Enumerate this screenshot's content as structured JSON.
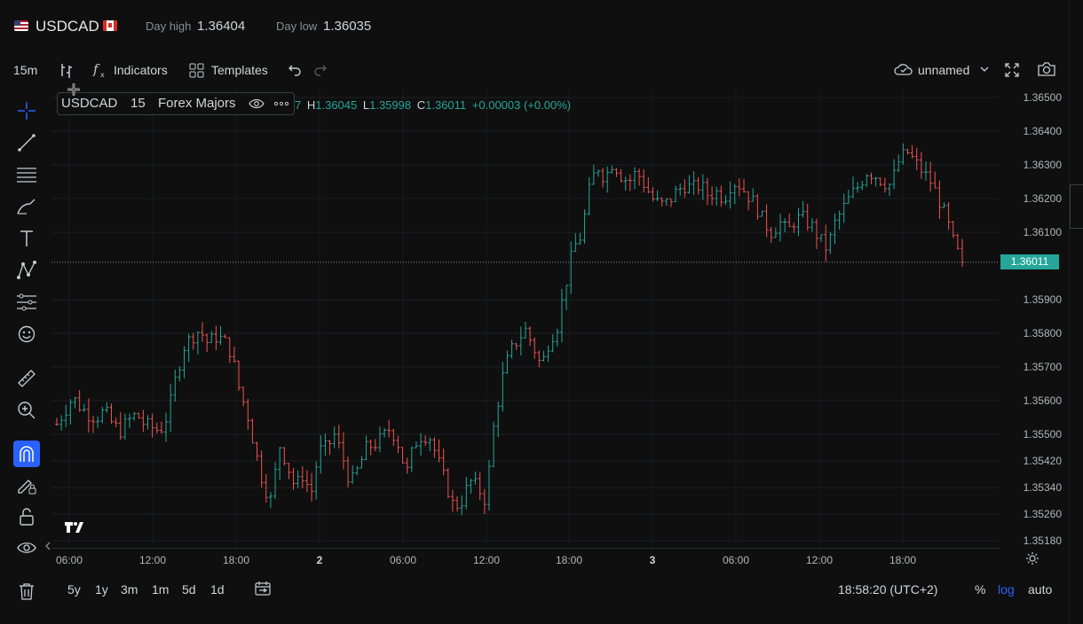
{
  "header": {
    "symbol": "USDCAD",
    "day_high_label": "Day high",
    "day_high_value": "1.36404",
    "day_low_label": "Day low",
    "day_low_value": "1.36035"
  },
  "toolbar": {
    "interval": "15m",
    "indicators_label": "Indicators",
    "templates_label": "Templates",
    "layout_name": "unnamed"
  },
  "legend": {
    "symbol": "USDCAD",
    "interval": "15",
    "exchange": "Forex Majors",
    "open_partial": "7",
    "h_label": "H",
    "h_value": "1.36045",
    "l_label": "L",
    "l_value": "1.35998",
    "c_label": "C",
    "c_value": "1.36011",
    "change": "+0.00003 (+0.00%)"
  },
  "price_axis": {
    "ticks": [
      "1.36500",
      "1.36400",
      "1.36300",
      "1.36200",
      "1.36100",
      "1.35900",
      "1.35800",
      "1.35700",
      "1.35600",
      "1.35500",
      "1.35420",
      "1.35340",
      "1.35260",
      "1.35180"
    ],
    "last_price": "1.36011",
    "last_price_color": "#26a69a"
  },
  "time_axis": {
    "ticks": [
      "06:00",
      "12:00",
      "18:00",
      "2",
      "06:00",
      "12:00",
      "18:00",
      "3",
      "06:00",
      "12:00",
      "18:00"
    ]
  },
  "bottom_bar": {
    "ranges": [
      "5y",
      "1y",
      "3m",
      "1m",
      "5d",
      "1d"
    ],
    "clock": "18:58:20 (UTC+2)",
    "percent": "%",
    "log": "log",
    "auto": "auto"
  },
  "colors": {
    "up": "#26a69a",
    "down": "#ef5350",
    "accent": "#2962ff"
  },
  "chart_data": {
    "type": "ohlc",
    "title": "USDCAD 15 Forex Majors",
    "x": [
      "06:00",
      "12:00",
      "18:00",
      "2",
      "06:00",
      "12:00",
      "18:00",
      "3",
      "06:00",
      "12:00",
      "18:00"
    ],
    "ylim": [
      1.3515,
      1.3653
    ],
    "path_close": [
      1.3553,
      1.3557,
      1.3561,
      1.3558,
      1.3556,
      1.3555,
      1.3557,
      1.3553,
      1.3551,
      1.3554,
      1.3556,
      1.3553,
      1.3552,
      1.3551,
      1.3556,
      1.3567,
      1.3576,
      1.3579,
      1.3581,
      1.3577,
      1.3579,
      1.3578,
      1.3574,
      1.3563,
      1.3556,
      1.3545,
      1.3535,
      1.353,
      1.3547,
      1.3541,
      1.3534,
      1.3538,
      1.3532,
      1.3545,
      1.3546,
      1.355,
      1.3543,
      1.3535,
      1.354,
      1.3546,
      1.3547,
      1.3549,
      1.3552,
      1.3547,
      1.3538,
      1.3547,
      1.355,
      1.3549,
      1.3542,
      1.3535,
      1.3528,
      1.353,
      1.3536,
      1.3534,
      1.353,
      1.3552,
      1.3566,
      1.3574,
      1.3578,
      1.3581,
      1.3576,
      1.357,
      1.3578,
      1.3582,
      1.3594,
      1.3605,
      1.3609,
      1.3622,
      1.363,
      1.3626,
      1.3631,
      1.3627,
      1.3625,
      1.3628,
      1.3624,
      1.362,
      1.3618,
      1.3619,
      1.3622,
      1.3624,
      1.3623,
      1.3624,
      1.3621,
      1.3622,
      1.362,
      1.3625,
      1.3624,
      1.3621,
      1.3618,
      1.3613,
      1.361,
      1.3613,
      1.361,
      1.3614,
      1.3614,
      1.3612,
      1.3608,
      1.3605,
      1.3613,
      1.3617,
      1.3621,
      1.3624,
      1.3628,
      1.3627,
      1.3625,
      1.3624,
      1.3631,
      1.3634,
      1.3631,
      1.3628,
      1.3625,
      1.362,
      1.3614,
      1.3606,
      1.3601
    ],
    "x_pixel_range_note": "",
    "last_price": 1.36011
  }
}
